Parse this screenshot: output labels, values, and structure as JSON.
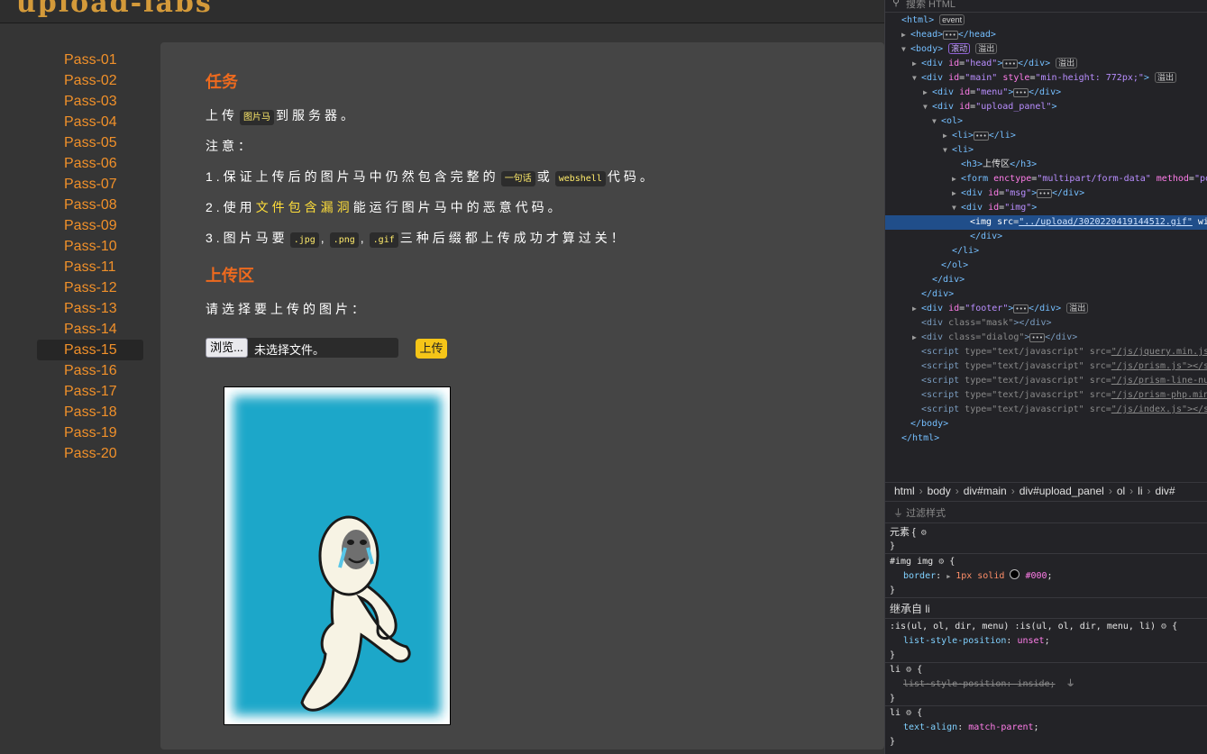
{
  "site": {
    "logo": "upload-labs",
    "menu": [
      "Pass-01",
      "Pass-02",
      "Pass-03",
      "Pass-04",
      "Pass-05",
      "Pass-06",
      "Pass-07",
      "Pass-08",
      "Pass-09",
      "Pass-10",
      "Pass-11",
      "Pass-12",
      "Pass-13",
      "Pass-14",
      "Pass-15",
      "Pass-16",
      "Pass-17",
      "Pass-18",
      "Pass-19",
      "Pass-20"
    ],
    "active_index": 14,
    "task": {
      "heading": "任务",
      "l1_pre": "上传",
      "l1_code": "图片马",
      "l1_post": "到服务器。",
      "l2": "注意：",
      "l3_pre": "1.保证上传后的图片马中仍然包含完整的",
      "l3_code1": "一句话",
      "l3_mid": "或",
      "l3_code2": "webshell",
      "l3_post": "代码。",
      "l4_pre": "2.使用",
      "l4_hl": "文件包含漏洞",
      "l4_post": "能运行图片马中的恶意代码。",
      "l5_pre": "3.图片马要",
      "l5_c1": ".jpg",
      "l5_c2": ".png",
      "l5_c3": ".gif",
      "l5_post": "三种后缀都上传成功才算过关！",
      "comma": ","
    },
    "upload": {
      "heading": "上传区",
      "prompt": "请选择要上传的图片：",
      "browse_label": "浏览...",
      "no_file": "未选择文件。",
      "submit_label": "上传"
    }
  },
  "devtools": {
    "search_placeholder": "搜索 HTML",
    "breadcrumbs": [
      "html",
      "body",
      "div#main",
      "div#upload_panel",
      "ol",
      "li",
      "div#"
    ],
    "filter_placeholder": "过滤样式",
    "tree": {
      "html_open": "<html>",
      "event": "event",
      "head": "<head>",
      "head_close": "</head>",
      "body": "<body>",
      "scroll": "滚动",
      "overflow": "溢出",
      "div_head_pre": "<div ",
      "id_attr": "id",
      "eq": "=",
      "q_head": "\"head\"",
      "gt": ">",
      "div_close": "</div>",
      "q_main": "\"main\"",
      "style_attr": "style",
      "q_main_style": "\"min-height: 772px;\"",
      "q_menu": "\"menu\"",
      "q_upload_panel": "\"upload_panel\"",
      "ol": "<ol>",
      "li": "<li>",
      "li_close": "</li>",
      "ol_close": "</ol>",
      "h3": "<h3>",
      "h3_text": "上传区",
      "h3_close": "</h3>",
      "form_pre": "<form ",
      "enctype_attr": "enctype",
      "q_enctype": "\"multipart/form-data\"",
      "method_attr": "method",
      "q_method": "\"po",
      "q_msg": "\"msg\"",
      "q_img": "\"img\"",
      "img_pre": "<img ",
      "src_attr": "src",
      "q_src": "\"../upload/3020220419144512.gif\"",
      "wi": "wi",
      "body_close": "</body>",
      "html_close": "</html>",
      "q_footer": "\"footer\"",
      "class_attr": "class",
      "q_mask": "\"mask\"",
      "q_dialog": "\"dialog\"",
      "script_pre": "<script ",
      "type_attr": "type",
      "q_type": "\"text/javascript\"",
      "scripts": [
        "\"/js/jquery.min.js",
        "\"/js/prism.js\"></s",
        "\"/js/prism-line-nu",
        "\"/js/prism-php.min",
        "\"/js/index.js\"></s"
      ]
    },
    "rules": {
      "element_sel": "元素 {",
      "close": "}",
      "img_sel": "#img img",
      "open": "{",
      "border_prop": "border",
      "border_val": "1px solid",
      "border_color": "#000",
      "inherit_label": "继承自 li",
      "is_sel": ":is(ul, ol, dir, menu) :is(ul, ol, dir, menu, li)",
      "lsp_prop": "list-style-position",
      "lsp_val": "unset",
      "li_sel": "li",
      "lsp_inside": "list-style-position: inside;",
      "ta_prop": "text-align",
      "ta_val": "match-parent",
      "colon": ":",
      "semi": ";"
    }
  }
}
